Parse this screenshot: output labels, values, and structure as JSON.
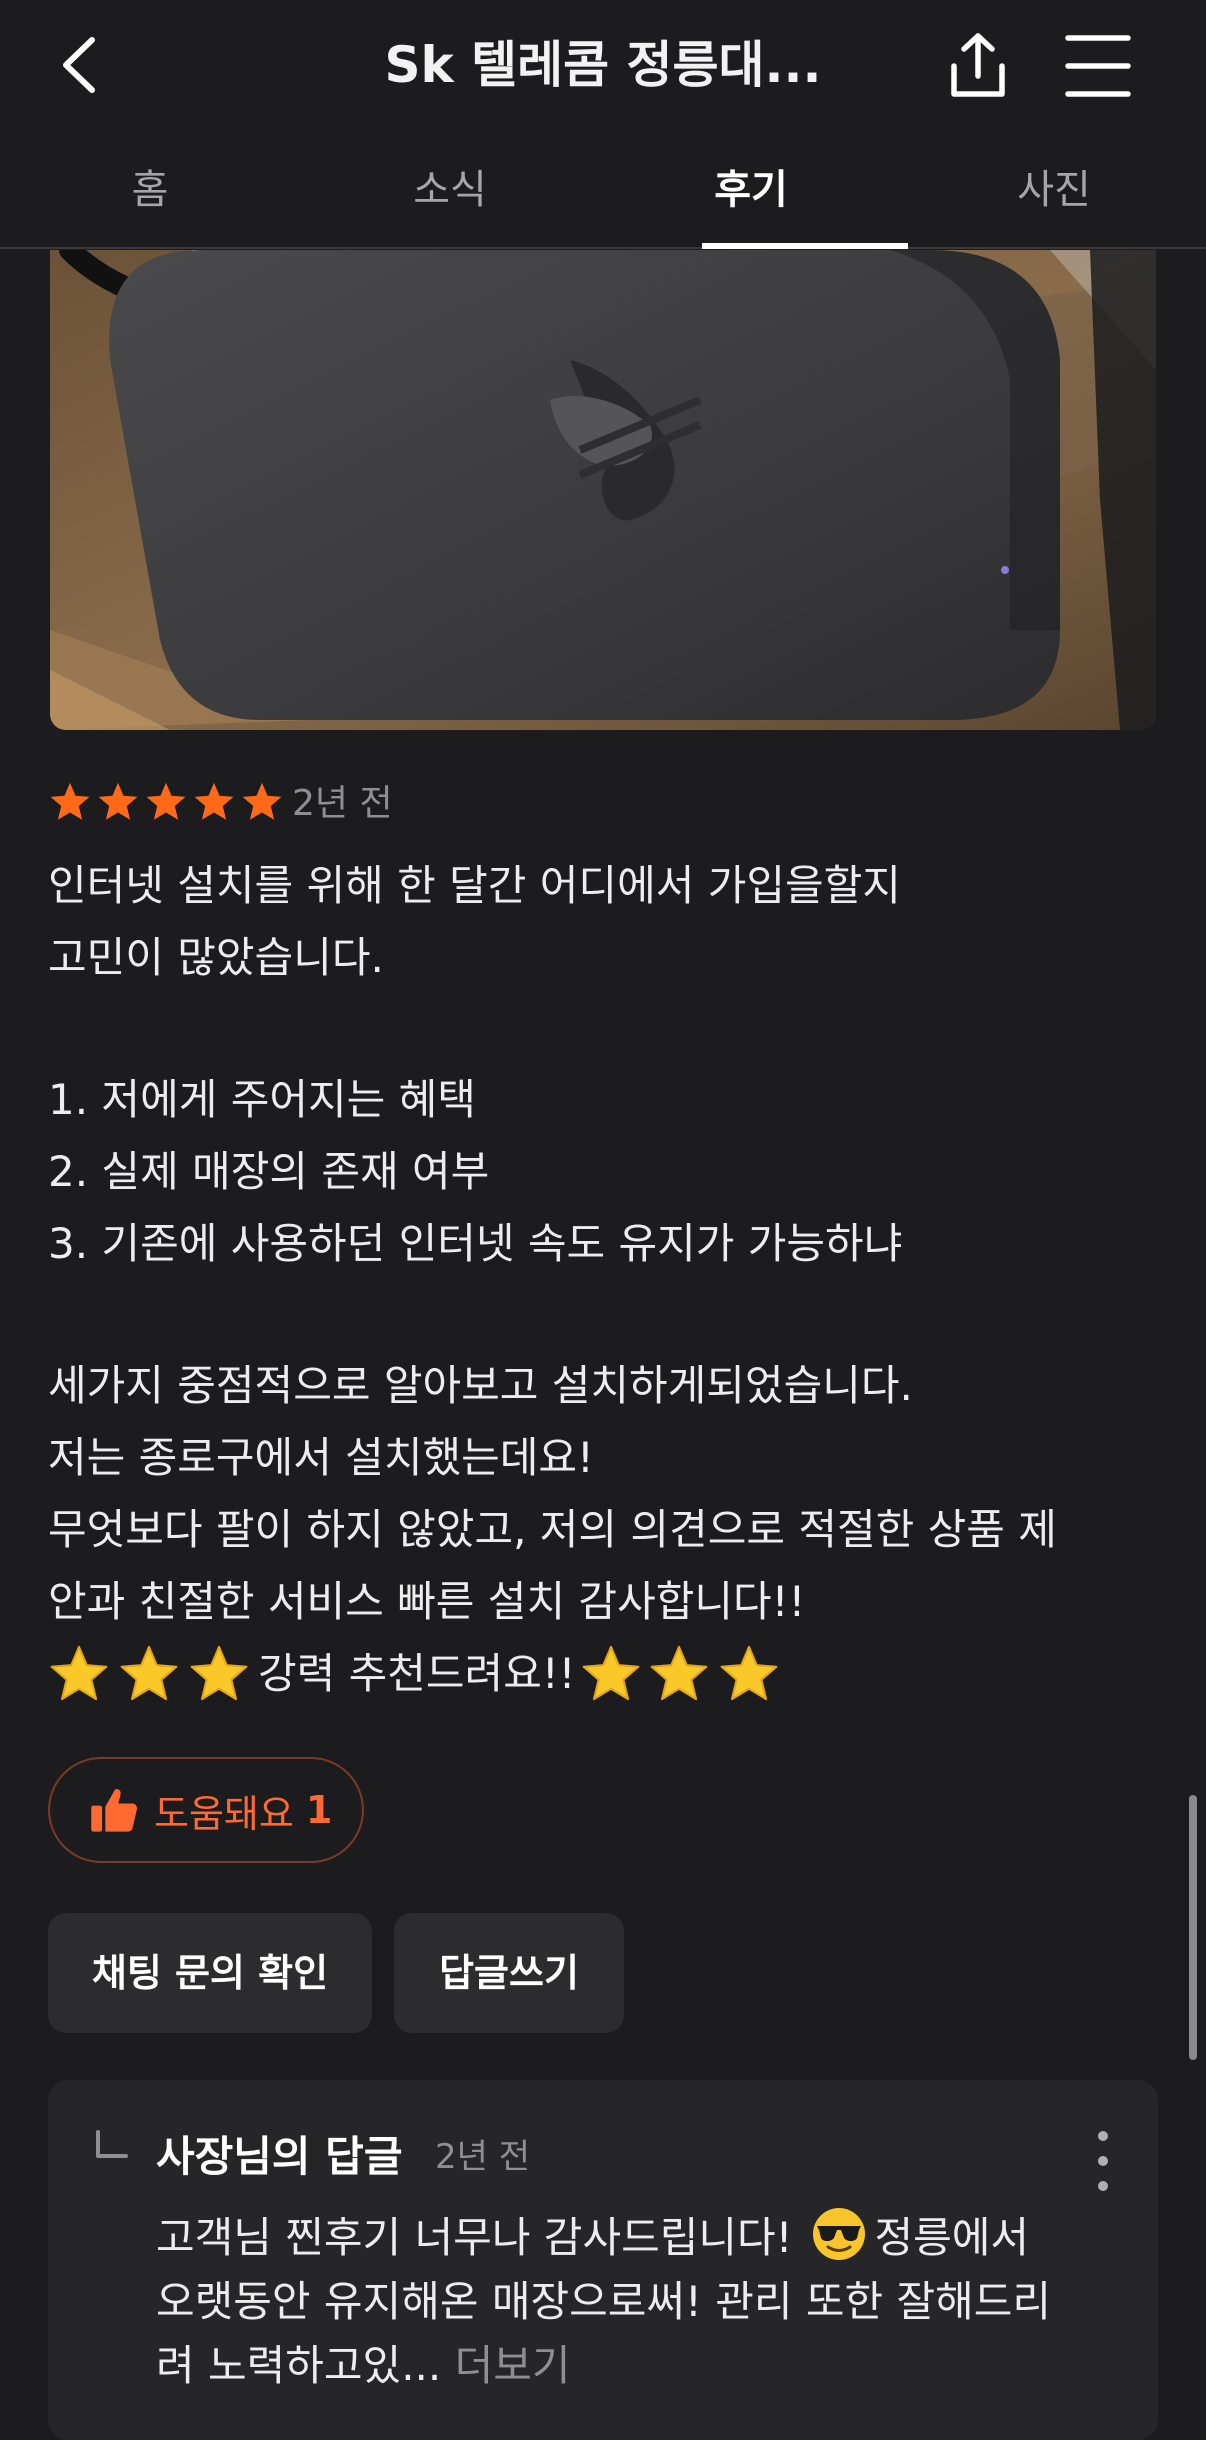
{
  "header": {
    "title": "Sk 텔레콤 정릉대..."
  },
  "tabs": [
    {
      "label": "홈",
      "active": false
    },
    {
      "label": "소식",
      "active": false
    },
    {
      "label": "후기",
      "active": true
    },
    {
      "label": "사진",
      "active": false
    }
  ],
  "review": {
    "rating": 5,
    "time": "2년 전",
    "lines": [
      "인터넷 설치를 위해 한 달간 어디에서 가입을할지",
      "고민이 많았습니다.",
      "1. 저에게 주어지는 혜택",
      "2. 실제 매장의 존재 여부",
      "3. 기존에 사용하던 인터넷 속도 유지가 가능하냐",
      "세가지 중점적으로 알아보고 설치하게되었습니다.",
      "저는 종로구에서 설치했는데요!",
      "무엇보다 팔이 하지 않았고, 저의 의견으로 적절한 상품 제",
      "안과 친절한 서비스 빠른 설치 감사합니다!!",
      "강력 추천드려요!!"
    ],
    "helpful_label": "도움돼요",
    "helpful_count": "1",
    "star_color": "#ff6a1a"
  },
  "actions": {
    "chat_label": "채팅 문의 확인",
    "reply_label": "답글쓰기"
  },
  "owner_reply": {
    "author": "사장님의 답글",
    "time": "2년 전",
    "line1_a": "고객님 찐후기 너무나 감사드립니다!",
    "line1_b": "정릉에서",
    "line2": "오랫동안 유지해온 매장으로써! 관리 또한 잘해드리",
    "line3": "려 노력하고있...",
    "see_more": "더보기"
  }
}
